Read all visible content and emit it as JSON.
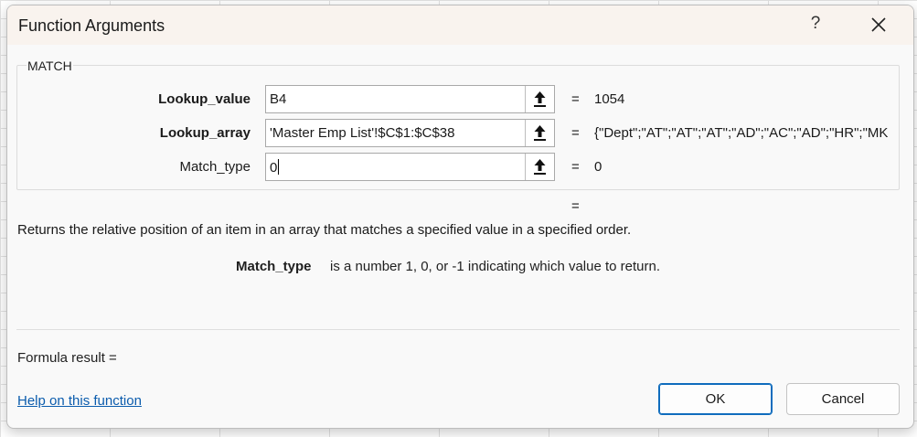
{
  "dialog": {
    "title": "Function Arguments",
    "help_symbol": "?",
    "function_name": "MATCH"
  },
  "arguments": [
    {
      "name": "Lookup_value",
      "value": "B4",
      "result": "1054"
    },
    {
      "name": "Lookup_array",
      "value": "'Master Emp List'!$C$1:$C$38",
      "result": "{\"Dept\";\"AT\";\"AT\";\"AT\";\"AD\";\"AC\";\"AD\";\"HR\";\"MK"
    },
    {
      "name": "Match_type",
      "value": "0",
      "result": "0"
    }
  ],
  "equals_sign": "=",
  "description": "Returns the relative position of an item in an array that matches a specified value in a specified order.",
  "parameter_help": {
    "name": "Match_type",
    "text": "is a number 1, 0, or -1 indicating which value to return."
  },
  "formula_result_label": "Formula result =",
  "help_link": "Help on this function",
  "buttons": {
    "ok": "OK",
    "cancel": "Cancel"
  },
  "icons": {
    "close": "close-icon",
    "ref": "collapse-dialog-arrow-icon"
  }
}
